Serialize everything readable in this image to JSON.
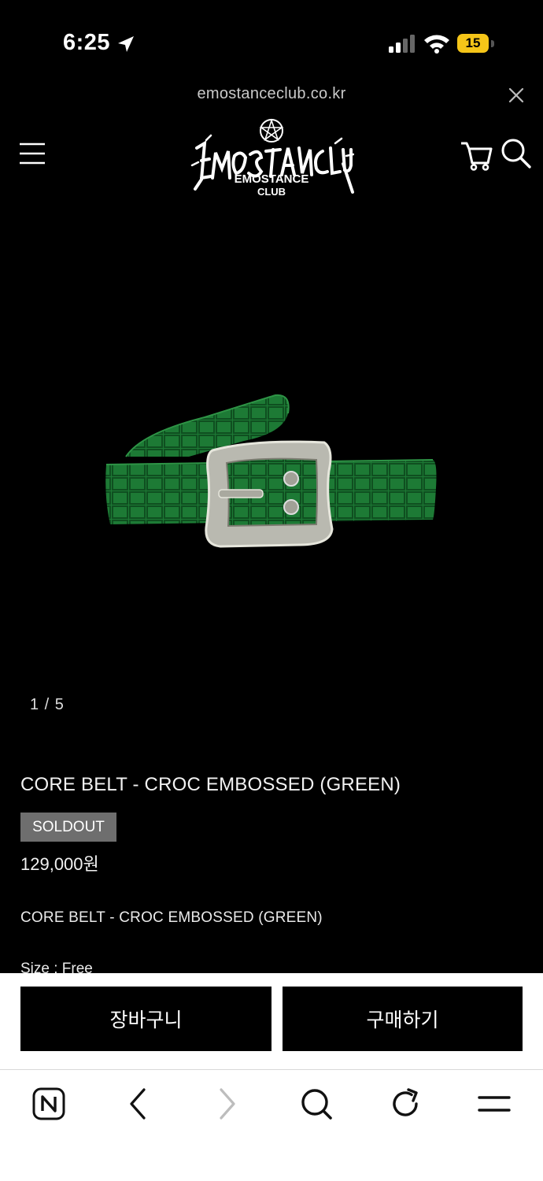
{
  "status_bar": {
    "time": "6:25",
    "battery": "15",
    "battery_color": "#f5c518"
  },
  "browser": {
    "url": "emostanceclub.co.kr"
  },
  "header": {
    "logo_alt": "EMOSTANCE CLUB",
    "logo_line1": "EMOSTANCE",
    "logo_line2": "CLUB",
    "icons": [
      "menu-icon",
      "cart-icon",
      "search-icon"
    ]
  },
  "product": {
    "image_counter": "1 / 5",
    "title": "CORE BELT - CROC EMBOSSED (GREEN)",
    "badge": "SOLDOUT",
    "price": "129,000원",
    "description_title": "CORE BELT - CROC EMBOSSED (GREEN)",
    "size_info": "Size : Free",
    "belt_color": "#1d7a35"
  },
  "actions": {
    "cart_label": "장바구니",
    "buy_label": "구매하기"
  },
  "toolbar": {
    "icons": [
      "naver-home-icon",
      "back-icon",
      "forward-icon",
      "search-icon",
      "reload-icon",
      "menu-icon"
    ]
  }
}
